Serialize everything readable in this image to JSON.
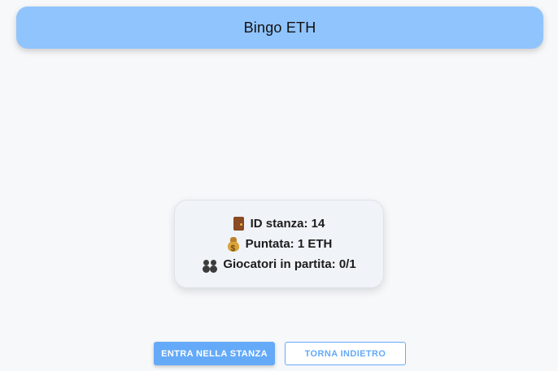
{
  "header": {
    "title": "Bingo ETH"
  },
  "room": {
    "id_label": "ID stanza: 14",
    "bet_label": "Puntata: 1 ETH",
    "players_label": "Giocatori in partita: 0/1",
    "icons": [
      "door-icon",
      "money-bag-icon",
      "players-icon"
    ]
  },
  "actions": {
    "enter_label": "ENTRA NELLA STANZA",
    "back_label": "TORNA INDIETRO"
  },
  "colors": {
    "header_bg": "#90c4fc",
    "accent": "#64aaf8",
    "page_bg": "#f7f8fa",
    "card_bg": "#f0f3f8"
  }
}
